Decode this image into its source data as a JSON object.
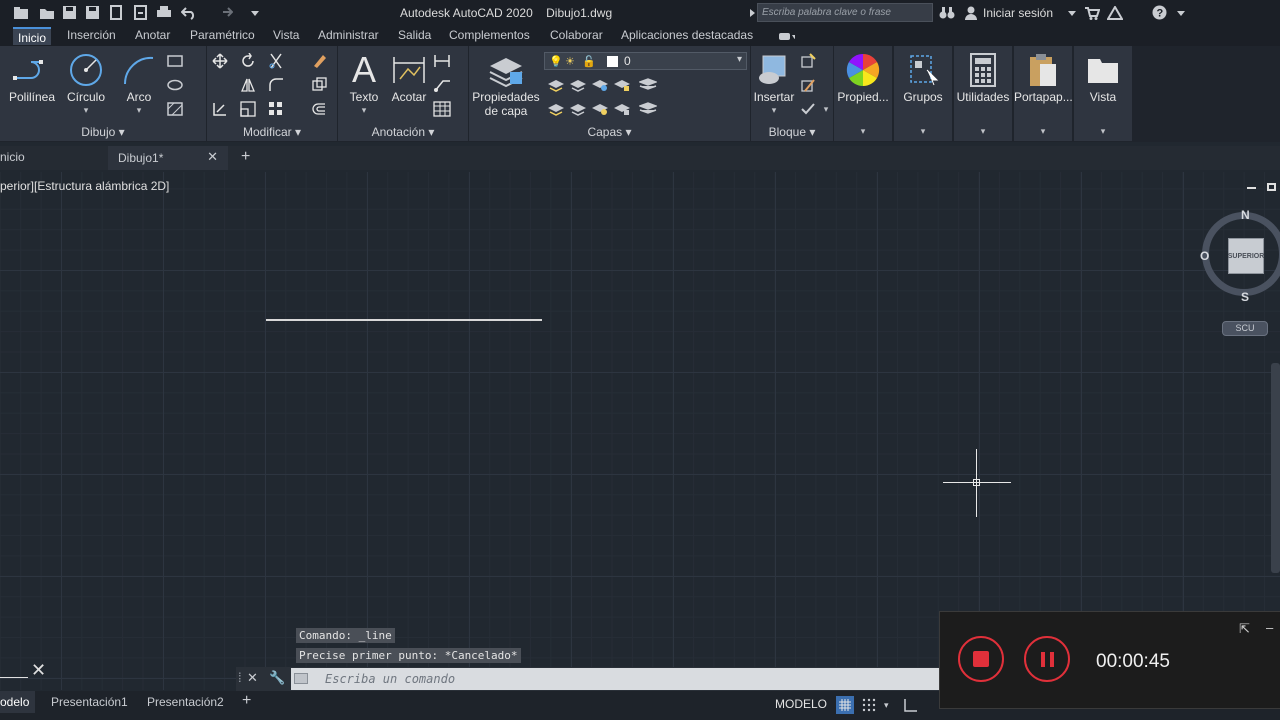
{
  "titlebar": {
    "app_title": "Autodesk AutoCAD 2020",
    "doc_title": "Dibujo1.dwg",
    "search_placeholder": "Escriba palabra clave o frase",
    "signin_label": "Iniciar sesión"
  },
  "ribbon_tabs": [
    "Inicio",
    "Inserción",
    "Anotar",
    "Paramétrico",
    "Vista",
    "Administrar",
    "Salida",
    "Complementos",
    "Colaborar",
    "Aplicaciones destacadas"
  ],
  "ribbon": {
    "dibujo": {
      "title": "Dibujo",
      "polilinea": "Polilínea",
      "circulo": "Círculo",
      "arco": "Arco"
    },
    "modificar": {
      "title": "Modificar"
    },
    "anotacion": {
      "title": "Anotación",
      "texto": "Texto",
      "acotar": "Acotar"
    },
    "capas": {
      "title": "Capas",
      "propiedades_1": "Propiedades",
      "propiedades_2": "de capa",
      "layer_value": "0"
    },
    "bloque": {
      "title": "Bloque",
      "insertar": "Insertar"
    },
    "propiedades": "Propied...",
    "grupos": "Grupos",
    "utilidades": "Utilidades",
    "portapapeles": "Portapap...",
    "vista": "Vista"
  },
  "file_tabs": {
    "start": "nicio",
    "doc": "Dibujo1*"
  },
  "viewport": {
    "label": "perior][Estructura alámbrica 2D]"
  },
  "viewcube": {
    "north": "N",
    "south": "S",
    "west": "O",
    "face": "SUPERIOR",
    "ucs": "SCU"
  },
  "command": {
    "history_1": "Comando: _line",
    "history_2": "Precise primer punto: *Cancelado*",
    "input_placeholder": "Escriba un comando"
  },
  "statusbar": {
    "tabs": [
      "odelo",
      "Presentación1",
      "Presentación2"
    ],
    "model_label": "MODELO"
  },
  "recorder": {
    "time": "00:00:45"
  },
  "colors": {
    "accent": "#4a90d9",
    "record_red": "#e0303a",
    "canvas_bg": "#212830"
  }
}
